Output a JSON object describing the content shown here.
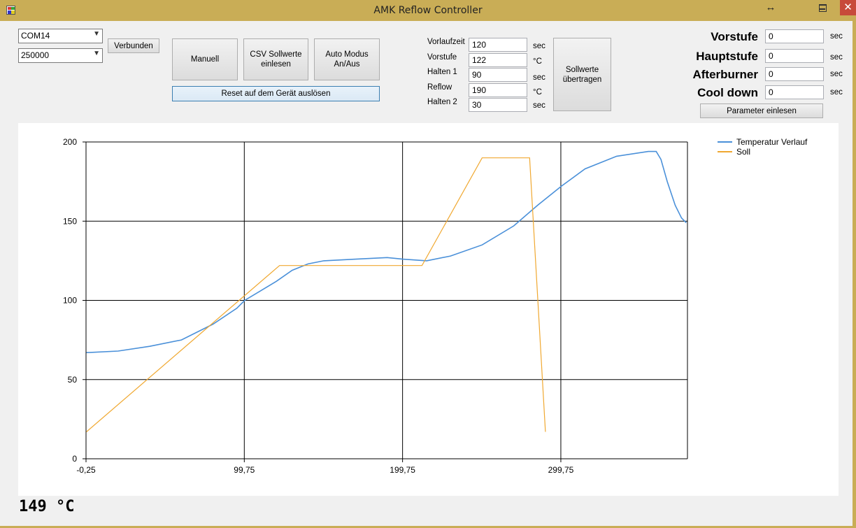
{
  "window": {
    "title": "AMK Reflow Controller",
    "resize_glyph": "↔",
    "close_glyph": "✕"
  },
  "connection": {
    "port": "COM14",
    "baud": "250000",
    "status_button": "Verbunden"
  },
  "buttons": {
    "manual": "Manuell",
    "csv_line1": "CSV Sollwerte",
    "csv_line2": "einlesen",
    "auto_line1": "Auto Modus",
    "auto_line2": "An/Aus",
    "reset": "Reset auf dem Gerät auslösen",
    "send_line1": "Sollwerte",
    "send_line2": "übertragen",
    "read_params": "Parameter einlesen"
  },
  "profile": [
    {
      "label": "Vorlaufzeit",
      "value": "120",
      "unit": "sec"
    },
    {
      "label": "Vorstufe",
      "value": "122",
      "unit": "°C"
    },
    {
      "label": "Halten 1",
      "value": "90",
      "unit": "sec"
    },
    {
      "label": "Reflow",
      "value": "190",
      "unit": "°C"
    },
    {
      "label": "Halten 2",
      "value": "30",
      "unit": "sec"
    }
  ],
  "stages": [
    {
      "label": "Vorstufe",
      "value": "0",
      "unit": "sec"
    },
    {
      "label": "Hauptstufe",
      "value": "0",
      "unit": "sec"
    },
    {
      "label": "Afterburner",
      "value": "0",
      "unit": "sec"
    },
    {
      "label": "Cool down",
      "value": "0",
      "unit": "sec"
    }
  ],
  "current_temperature": "149 °C",
  "chart_data": {
    "type": "line",
    "x_ticks": [
      "-0,25",
      "99,75",
      "199,75",
      "299,75"
    ],
    "y_ticks": [
      "0",
      "50",
      "100",
      "150",
      "200"
    ],
    "xlim": [
      -0.25,
      379.75
    ],
    "ylim": [
      0,
      200
    ],
    "grid": true,
    "legend_position": "top-right",
    "series": [
      {
        "name": "Temperatur Verlauf",
        "color": "#4a90d9",
        "points": [
          [
            0,
            67
          ],
          [
            20,
            68
          ],
          [
            40,
            71
          ],
          [
            60,
            75
          ],
          [
            80,
            85
          ],
          [
            95,
            95
          ],
          [
            100,
            100
          ],
          [
            110,
            106
          ],
          [
            120,
            112
          ],
          [
            130,
            119
          ],
          [
            140,
            123
          ],
          [
            150,
            125
          ],
          [
            170,
            126
          ],
          [
            190,
            127
          ],
          [
            200,
            126
          ],
          [
            215,
            125
          ],
          [
            230,
            128
          ],
          [
            250,
            135
          ],
          [
            270,
            147
          ],
          [
            285,
            160
          ],
          [
            300,
            172
          ],
          [
            315,
            183
          ],
          [
            335,
            191
          ],
          [
            355,
            194
          ],
          [
            360,
            194
          ],
          [
            363,
            189
          ],
          [
            367,
            175
          ],
          [
            372,
            160
          ],
          [
            376,
            152
          ],
          [
            379,
            149
          ]
        ]
      },
      {
        "name": "Soll",
        "color": "#f0a830",
        "points": [
          [
            0,
            17
          ],
          [
            122,
            122
          ],
          [
            212,
            122
          ],
          [
            250,
            190
          ],
          [
            280,
            190
          ],
          [
            290,
            17
          ]
        ]
      }
    ]
  }
}
